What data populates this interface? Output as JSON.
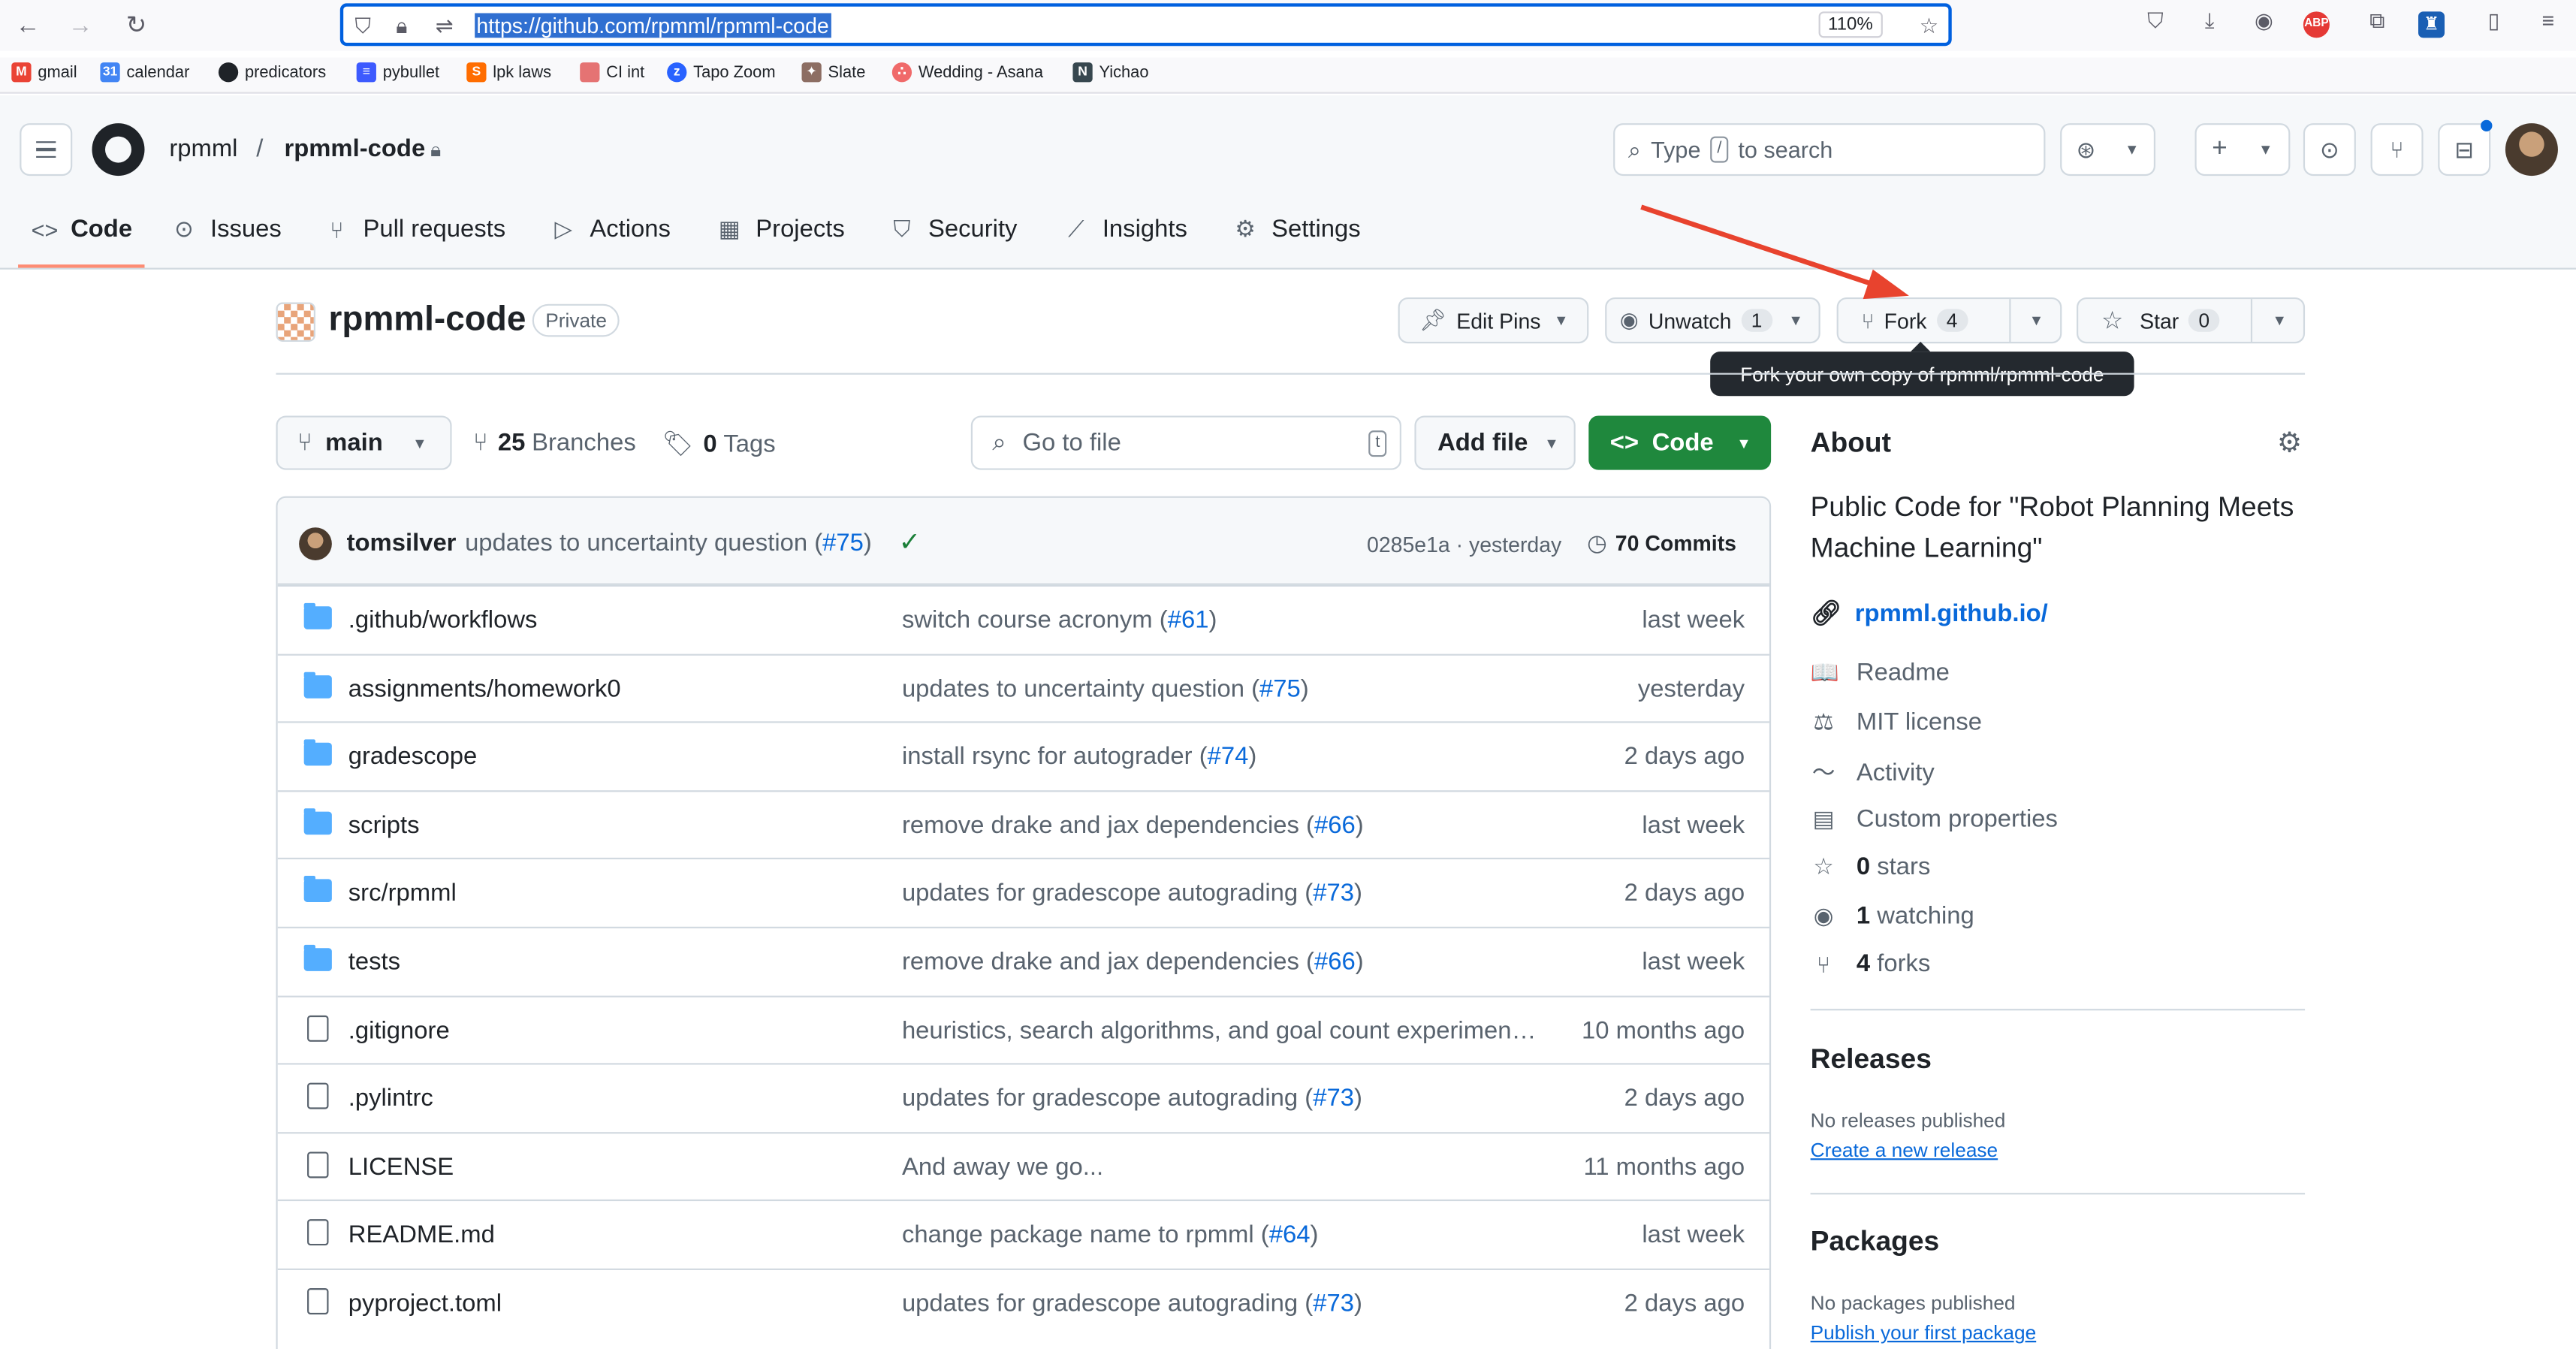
{
  "browser": {
    "url": "https://github.com/rpmml/rpmml-code",
    "zoom": "110%",
    "bookmarks": [
      {
        "label": "gmail",
        "color": "#ea4335"
      },
      {
        "label": "calendar",
        "color": "#4285f4"
      },
      {
        "label": "predicators",
        "color": "#1f2328"
      },
      {
        "label": "pybullet",
        "color": "#3d5afe"
      },
      {
        "label": "lpk laws",
        "color": "#ff6d00"
      },
      {
        "label": "CI int",
        "color": "#e57373"
      },
      {
        "label": "Tapo Zoom",
        "color": "#2962ff"
      },
      {
        "label": "Slate",
        "color": "#8d6e63"
      },
      {
        "label": "Wedding - Asana",
        "color": "#f06a6a"
      },
      {
        "label": "Yichao",
        "color": "#37474f"
      }
    ]
  },
  "header": {
    "owner": "rpmml",
    "separator": "/",
    "repo": "rpmml-code",
    "search_placeholder_pre": "Type",
    "search_key": "/",
    "search_placeholder_post": "to search"
  },
  "tabs": [
    {
      "label": "Code",
      "icon": "code-icon",
      "glyph": "<>"
    },
    {
      "label": "Issues",
      "icon": "issue-icon",
      "glyph": "⊙"
    },
    {
      "label": "Pull requests",
      "icon": "pull-request-icon",
      "glyph": "⑂"
    },
    {
      "label": "Actions",
      "icon": "play-icon",
      "glyph": "▷"
    },
    {
      "label": "Projects",
      "icon": "table-icon",
      "glyph": "▦"
    },
    {
      "label": "Security",
      "icon": "shield-icon",
      "glyph": "⛉"
    },
    {
      "label": "Insights",
      "icon": "graph-icon",
      "glyph": "⟋"
    },
    {
      "label": "Settings",
      "icon": "gear-icon",
      "glyph": "⚙"
    }
  ],
  "repo": {
    "name": "rpmml-code",
    "visibility": "Private",
    "edit_pins": "Edit Pins",
    "unwatch": "Unwatch",
    "watch_count": "1",
    "fork": "Fork",
    "fork_count": "4",
    "star": "Star",
    "star_count": "0",
    "fork_tooltip": "Fork your own copy of rpmml/rpmml-code"
  },
  "toolbar": {
    "branch": "main",
    "branches_count": "25",
    "branches_label": "Branches",
    "tags_count": "0",
    "tags_label": "Tags",
    "goto_placeholder": "Go to file",
    "goto_key": "t",
    "add_file": "Add file",
    "code": "Code"
  },
  "latest_commit": {
    "author": "tomsilver",
    "message": "updates to uncertainty question (",
    "pr": "#75",
    "message_end": ")",
    "sha_date": "0285e1a · yesterday",
    "commits": "70 Commits"
  },
  "files": [
    {
      "type": "folder",
      "name": ".github/workflows",
      "msg": "switch course acronym (",
      "pr": "#61",
      "end": ")",
      "date": "last week"
    },
    {
      "type": "folder",
      "name": "assignments/homework0",
      "msg": "updates to uncertainty question (",
      "pr": "#75",
      "end": ")",
      "date": "yesterday"
    },
    {
      "type": "folder",
      "name": "gradescope",
      "msg": "install rsync for autograder (",
      "pr": "#74",
      "end": ")",
      "date": "2 days ago"
    },
    {
      "type": "folder",
      "name": "scripts",
      "msg": "remove drake and jax dependencies (",
      "pr": "#66",
      "end": ")",
      "date": "last week"
    },
    {
      "type": "folder",
      "name": "src/rpmml",
      "msg": "updates for gradescope autograding (",
      "pr": "#73",
      "end": ")",
      "date": "2 days ago"
    },
    {
      "type": "folder",
      "name": "tests",
      "msg": "remove drake and jax dependencies (",
      "pr": "#66",
      "end": ")",
      "date": "last week"
    },
    {
      "type": "file",
      "name": ".gitignore",
      "msg": "heuristics, search algorithms, and goal count experiment …",
      "pr": "",
      "end": "",
      "date": "10 months ago"
    },
    {
      "type": "file",
      "name": ".pylintrc",
      "msg": "updates for gradescope autograding (",
      "pr": "#73",
      "end": ")",
      "date": "2 days ago"
    },
    {
      "type": "file",
      "name": "LICENSE",
      "msg": "And away we go...",
      "pr": "",
      "end": "",
      "date": "11 months ago"
    },
    {
      "type": "file",
      "name": "README.md",
      "msg": "change package name to rpmml (",
      "pr": "#64",
      "end": ")",
      "date": "last week"
    },
    {
      "type": "file",
      "name": "pyproject.toml",
      "msg": "updates for gradescope autograding (",
      "pr": "#73",
      "end": ")",
      "date": "2 days ago"
    }
  ],
  "about": {
    "title": "About",
    "description": "Public Code for \"Robot Planning Meets Machine Learning\"",
    "website": "rpmml.github.io/",
    "items": [
      {
        "icon": "book-icon",
        "glyph": "📖",
        "bold": "",
        "label": "Readme"
      },
      {
        "icon": "law-icon",
        "glyph": "⚖",
        "bold": "",
        "label": "MIT license"
      },
      {
        "icon": "pulse-icon",
        "glyph": "〜",
        "bold": "",
        "label": "Activity"
      },
      {
        "icon": "note-icon",
        "glyph": "▤",
        "bold": "",
        "label": "Custom properties"
      },
      {
        "icon": "star-icon",
        "glyph": "☆",
        "bold": "0",
        "label": "stars"
      },
      {
        "icon": "eye-icon",
        "glyph": "◉",
        "bold": "1",
        "label": "watching"
      },
      {
        "icon": "fork-icon",
        "glyph": "⑂",
        "bold": "4",
        "label": "forks"
      }
    ]
  },
  "releases": {
    "title": "Releases",
    "note": "No releases published",
    "link": "Create a new release"
  },
  "packages": {
    "title": "Packages",
    "note": "No packages published",
    "link": "Publish your first package"
  },
  "colors": {
    "accent_link": "#0969da",
    "code_button": "#1f883d",
    "tab_underline": "#fd8c73",
    "annotation_arrow": "#e8432e"
  }
}
